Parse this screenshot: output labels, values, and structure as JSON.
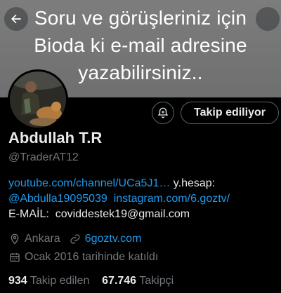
{
  "banner": {
    "lines": [
      "Soru ve görüşleriniz için",
      "Bioda ki e-mail adresine",
      "yazabilirsiniz.."
    ],
    "background": "#757575"
  },
  "header": {
    "back_icon": "arrow-left-icon"
  },
  "actions": {
    "follow_label": "Takip ediliyor",
    "notify_icon": "bell-plus-icon"
  },
  "profile": {
    "name": "Abdullah T.R",
    "handle": "@TraderAT12",
    "bio": {
      "youtube_link": "youtube.com/channel/UCa5J1…",
      "alt_account_label": " y.hesap:",
      "alt_account_link": "@Abdulla19095039",
      "instagram_link": "instagram.com/6.goztv/",
      "email_label": "E-MAİL:",
      "email_value": "coviddestek19@gmail.com"
    },
    "location": "Ankara",
    "website": "6goztv.com",
    "joined": "Ocak 2016 tarihinde katıldı"
  },
  "stats": {
    "following_count": "934",
    "following_label": "Takip edilen",
    "followers_count": "67.746",
    "followers_label": "Takipçi"
  },
  "colors": {
    "accent": "#1d9bf0",
    "muted": "#71767b",
    "text": "#e7e9ea"
  }
}
